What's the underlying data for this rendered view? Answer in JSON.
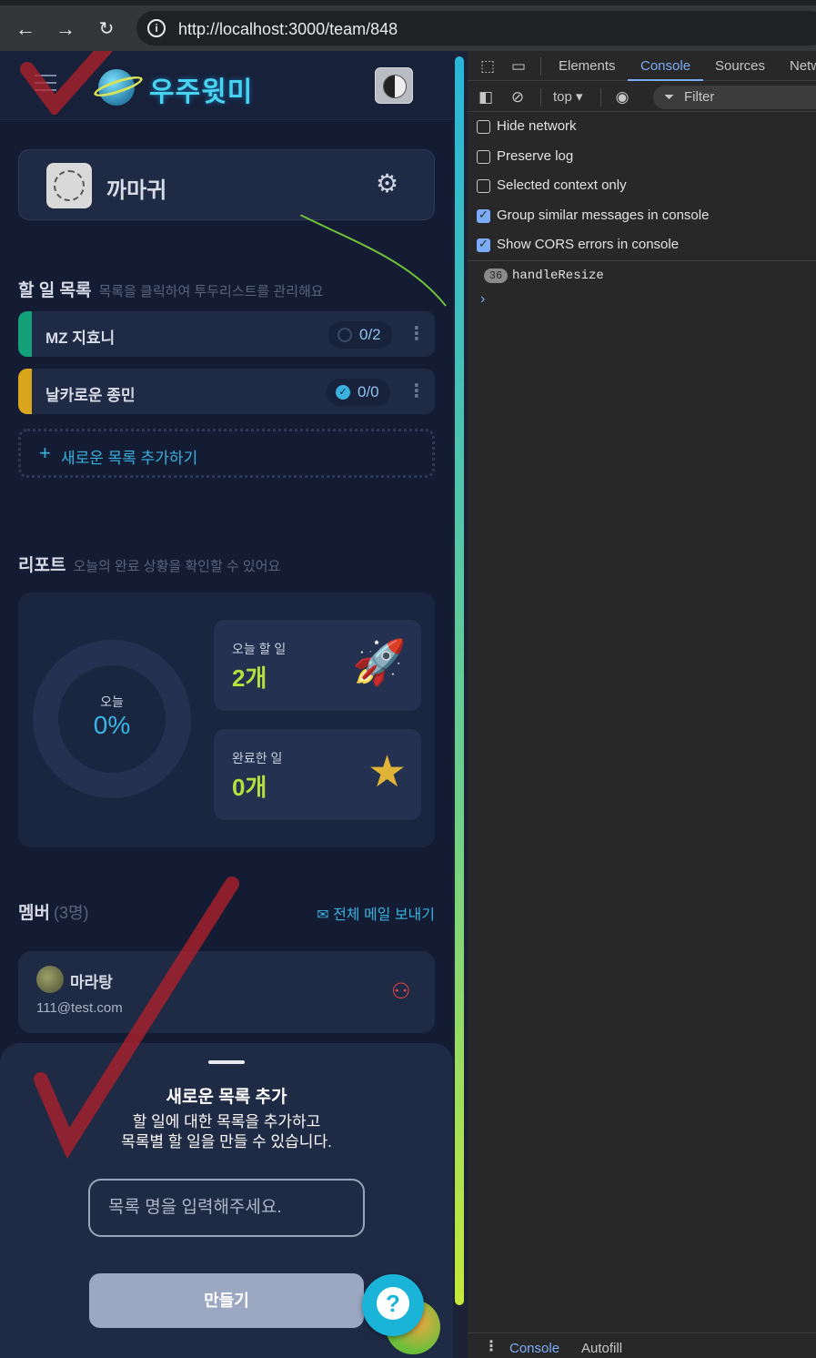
{
  "browser": {
    "back_icon": "arrow-left",
    "forward_icon": "arrow-right",
    "reload_icon": "reload",
    "url": "http://localhost:3000/team/848"
  },
  "app": {
    "header": {
      "logo_text": "우주윗미"
    },
    "team": {
      "name": "까마귀"
    },
    "todo_section": {
      "title": "할 일 목록",
      "subtitle": "목록을 클릭하여 투두리스트를 관리해요",
      "items": [
        {
          "label": "MZ 지효니",
          "count": "0/2",
          "color": "#14a078",
          "done": false
        },
        {
          "label": "날카로운 종민",
          "count": "0/0",
          "color": "#d9a51a",
          "done": true
        }
      ],
      "add_label": "새로운 목록 추가하기"
    },
    "report_section": {
      "title": "리포트",
      "subtitle": "오늘의 완료 상황을 확인할 수 있어요",
      "donut_label": "오늘",
      "donut_value": "0%",
      "today_label": "오늘 할 일",
      "today_value": "2개",
      "done_label": "완료한 일",
      "done_value": "0개"
    },
    "members_section": {
      "title": "멤버",
      "count": "(3명)",
      "mail_all": "전체 메일 보내기",
      "members": [
        {
          "name": "마라탕",
          "email": "111@test.com"
        }
      ]
    },
    "sheet": {
      "title": "새로운 목록 추가",
      "desc_line1": "할 일에 대한 목록을 추가하고",
      "desc_line2": "목록별 할 일을 만들 수 있습니다.",
      "input_placeholder": "목록 명을 입력해주세요.",
      "button": "만들기"
    },
    "help_fab_label": "?"
  },
  "devtools": {
    "tabs": [
      "Elements",
      "Console",
      "Sources",
      "Netw"
    ],
    "active_tab": "Console",
    "context": "top",
    "filter_placeholder": "Filter",
    "settings": [
      {
        "label": "Hide network",
        "checked": false
      },
      {
        "label": "Preserve log",
        "checked": false
      },
      {
        "label": "Selected context only",
        "checked": false
      },
      {
        "label": "Group similar messages in console",
        "checked": true
      },
      {
        "label": "Show CORS errors in console",
        "checked": true
      }
    ],
    "log": {
      "count": "36",
      "message": "handleResize"
    },
    "drawer_tabs": [
      "Console",
      "Autofill"
    ]
  },
  "colors": {
    "accent": "#3ab2e0",
    "success": "#b7df3e",
    "devtools_accent": "#7cacf8",
    "danger": "#e0484e"
  }
}
